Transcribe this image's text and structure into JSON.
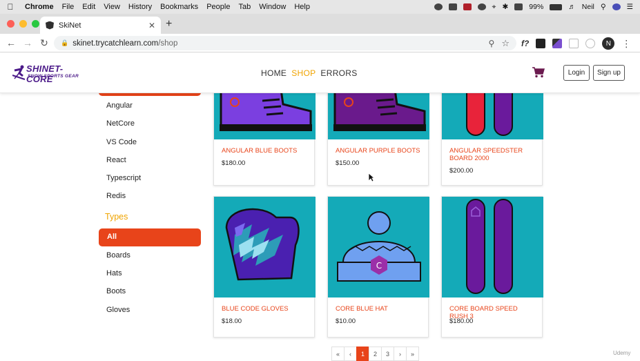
{
  "mac_menubar": {
    "app": "Chrome",
    "menus": [
      "File",
      "Edit",
      "View",
      "History",
      "Bookmarks",
      "People",
      "Tab",
      "Window",
      "Help"
    ],
    "battery": "99%",
    "user": "Neil"
  },
  "browser": {
    "tab_title": "SkiNet",
    "url_host": "skinet.trycatchlearn.com",
    "url_path": "/shop",
    "profile_initial": "N"
  },
  "site": {
    "logo_line1": "SHINET-CORE",
    "logo_line2": "SNOW SPORTS GEAR",
    "nav": [
      "HOME",
      "SHOP",
      "ERRORS"
    ],
    "active_nav": "SHOP",
    "login": "Login",
    "signup": "Sign up"
  },
  "sidebar": {
    "brands": [
      "Angular",
      "NetCore",
      "VS Code",
      "React",
      "Typescript",
      "Redis"
    ],
    "types_heading": "Types",
    "types": [
      "All",
      "Boards",
      "Hats",
      "Boots",
      "Gloves"
    ],
    "active_type": "All"
  },
  "products": [
    {
      "name": "ANGULAR BLUE BOOTS",
      "price": "$180.00",
      "image": "blue-boot-icon"
    },
    {
      "name": "ANGULAR PURPLE BOOTS",
      "price": "$150.00",
      "image": "purple-boot-icon"
    },
    {
      "name": "ANGULAR SPEEDSTER BOARD 2000",
      "price": "$200.00",
      "image": "snowboard-icon"
    },
    {
      "name": "BLUE CODE GLOVES",
      "price": "$18.00",
      "image": "glove-icon"
    },
    {
      "name": "CORE BLUE HAT",
      "price": "$10.00",
      "image": "beanie-icon"
    },
    {
      "name": "CORE BOARD SPEED RUSH 3",
      "price": "$180.00",
      "image": "snowboard-icon"
    }
  ],
  "pagination": {
    "first": "«",
    "prev": "‹",
    "pages": [
      "1",
      "2",
      "3"
    ],
    "current": "1",
    "next": "›",
    "last": "»"
  },
  "colors": {
    "accent_orange": "#e8441a",
    "active_link": "#f0a400",
    "product_bg": "#14aab8",
    "brand_purple": "#4b1a89"
  },
  "watermark": "Udemy"
}
